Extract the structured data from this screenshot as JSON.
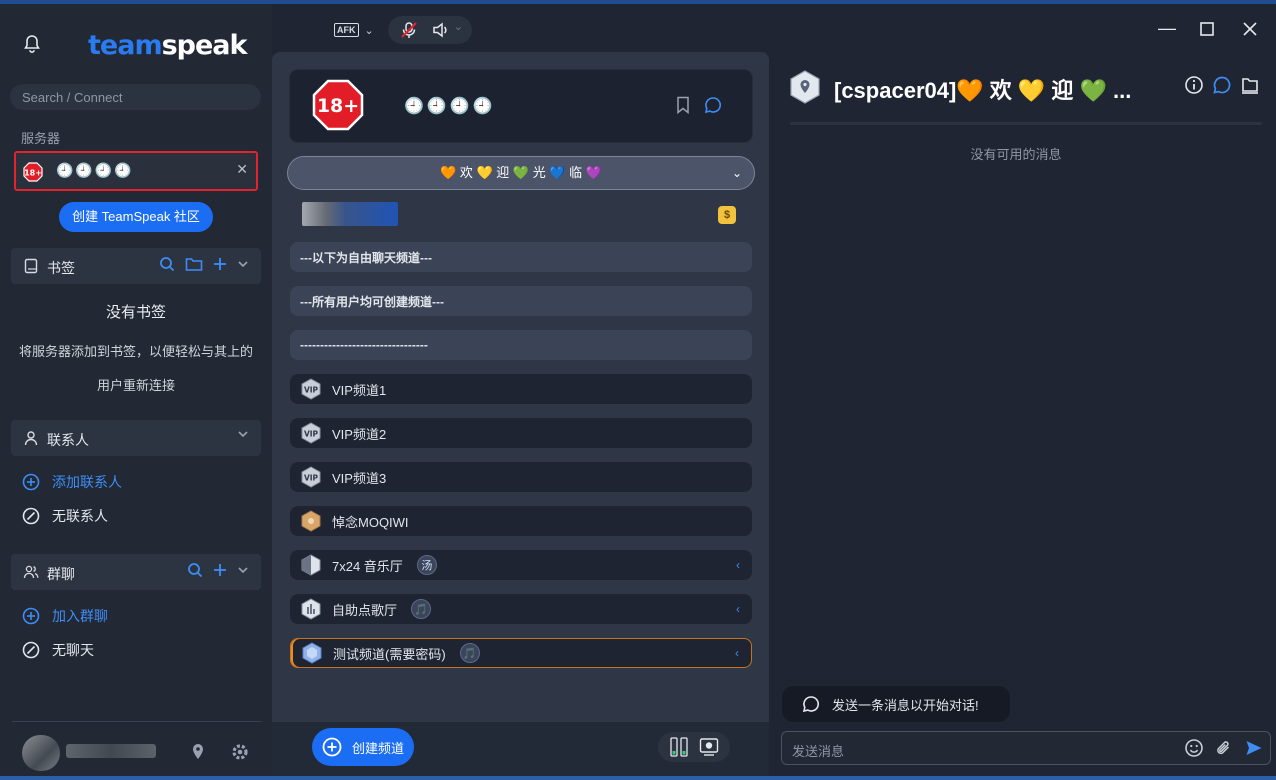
{
  "app": {
    "logo_prefix": "team",
    "logo_suffix": "speak"
  },
  "sidebar": {
    "search_placeholder": "Search / Connect",
    "servers_label": "服务器",
    "server": {
      "name": "🕘🕘🕘🕘",
      "badge": "18+"
    },
    "create_community": "创建 TeamSpeak 社区",
    "bookmarks": {
      "label": "书签",
      "empty_title": "没有书签",
      "empty_desc": "将服务器添加到书签，以便轻松与其上的用户重新连接"
    },
    "contacts": {
      "label": "联系人",
      "add": "添加联系人",
      "none": "无联系人"
    },
    "groups": {
      "label": "群聊",
      "join": "加入群聊",
      "none": "无聊天"
    }
  },
  "topbar": {
    "afk": "AFK"
  },
  "center": {
    "banner": {
      "badge": "18+",
      "name": "🕘🕘🕘🕘"
    },
    "welcome": "🧡 欢 💛 迎 💚 光 💙 临 💜",
    "gold_badge": "$",
    "channels": [
      {
        "label": "---以下为自由聊天频道---",
        "type": "separator"
      },
      {
        "label": "---所有用户均可创建频道---",
        "type": "separator"
      },
      {
        "label": "--------------------------------",
        "type": "separator"
      },
      {
        "label": "VIP频道1",
        "type": "vip"
      },
      {
        "label": "VIP频道2",
        "type": "vip"
      },
      {
        "label": "VIP频道3",
        "type": "vip"
      },
      {
        "label": "悼念MOQIWI",
        "type": "memorial"
      },
      {
        "label": "7x24 音乐厅",
        "type": "music",
        "user": "汤"
      },
      {
        "label": "自助点歌厅",
        "type": "music",
        "user": "🎵"
      },
      {
        "label": "测试频道(需要密码)",
        "type": "locked",
        "user": "🎵"
      }
    ],
    "create_channel": "创建频道"
  },
  "chat": {
    "title": "[cspacer04]🧡 欢 💛 迎 💚 ...",
    "no_messages": "没有可用的消息",
    "start_tip": "发送一条消息以开始对话!",
    "input_placeholder": "发送消息"
  },
  "colors": {
    "accent": "#1b6ef3",
    "danger": "#e4232d",
    "bg": "#1f2532"
  }
}
